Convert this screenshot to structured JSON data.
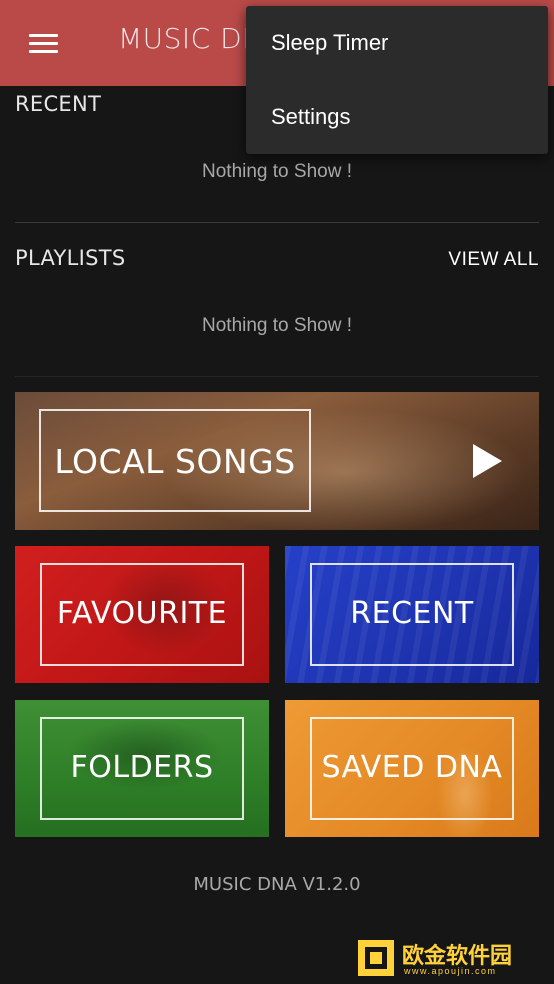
{
  "toolbar": {
    "title": "MUSIC DN",
    "menu_icon": "hamburger-menu-icon",
    "color": "#b94a48"
  },
  "overflow_menu": {
    "items": [
      {
        "label": "Sleep Timer"
      },
      {
        "label": "Settings"
      }
    ]
  },
  "recent": {
    "title": "RECENT",
    "empty": "Nothing to Show !"
  },
  "playlists": {
    "title": "PLAYLISTS",
    "view_all": "VIEW ALL",
    "empty": "Nothing to Show !"
  },
  "tiles": {
    "local_songs": {
      "label": "LOCAL SONGS",
      "icon": "play-icon"
    },
    "favourite": {
      "label": "FAVOURITE",
      "color": "#d11f1f"
    },
    "recent": {
      "label": "RECENT",
      "color": "#2540c8"
    },
    "folders": {
      "label": "FOLDERS",
      "color": "#2f8028"
    },
    "saved_dna": {
      "label": "SAVED DNA",
      "color": "#e48a26"
    }
  },
  "footer": {
    "version": "MUSIC DNA V1.2.0"
  },
  "watermark": {
    "text": "欧金软件园",
    "url": "www.apoujin.com"
  }
}
